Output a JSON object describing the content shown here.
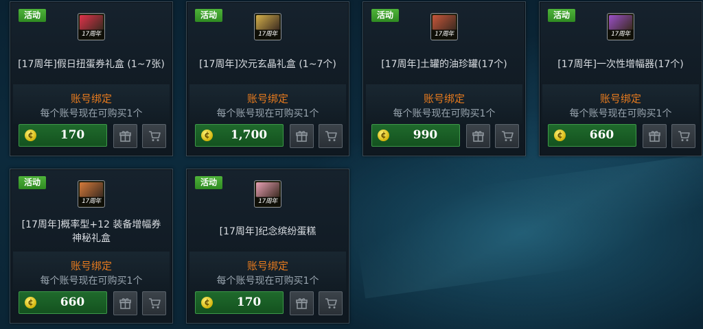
{
  "products": [
    {
      "badge": "活动",
      "icon_label": "17周年",
      "icon": "ticket-icon",
      "icon_color": "#e0324a",
      "name": "[17周年]假日扭蛋券礼盒 (1~7张)",
      "bind": "账号绑定",
      "limit": "每个账号现在可购买1个",
      "price": "170"
    },
    {
      "badge": "活动",
      "icon_label": "17周年",
      "icon": "crystal-box-icon",
      "icon_color": "#d4b04a",
      "name": "[17周年]次元玄晶礼盒 (1~7个)",
      "bind": "账号绑定",
      "limit": "每个账号现在可购买1个",
      "price": "1,700"
    },
    {
      "badge": "活动",
      "icon_label": "17周年",
      "icon": "jar-icon",
      "icon_color": "#c8563a",
      "name": "[17周年]土罐的油珍罐(17个)",
      "bind": "账号绑定",
      "limit": "每个账号现在可购买1个",
      "price": "990"
    },
    {
      "badge": "活动",
      "icon_label": "17周年",
      "icon": "amplifier-icon",
      "icon_color": "#9a50c8",
      "name": "[17周年]一次性增幅器(17个)",
      "bind": "账号绑定",
      "limit": "每个账号现在可购买1个",
      "price": "660"
    },
    {
      "badge": "活动",
      "icon_label": "17周年",
      "icon": "mystery-box-icon",
      "icon_color": "#d67a3a",
      "name": "[17周年]概率型+12 装备增幅券神秘礼盒",
      "bind": "账号绑定",
      "limit": "每个账号现在可购买1个",
      "price": "660"
    },
    {
      "badge": "活动",
      "icon_label": "17周年",
      "icon": "cake-icon",
      "icon_color": "#e8a0b4",
      "name": "[17周年]纪念缤纷蛋糕",
      "bind": "账号绑定",
      "limit": "每个账号现在可购买1个",
      "price": "170"
    }
  ]
}
